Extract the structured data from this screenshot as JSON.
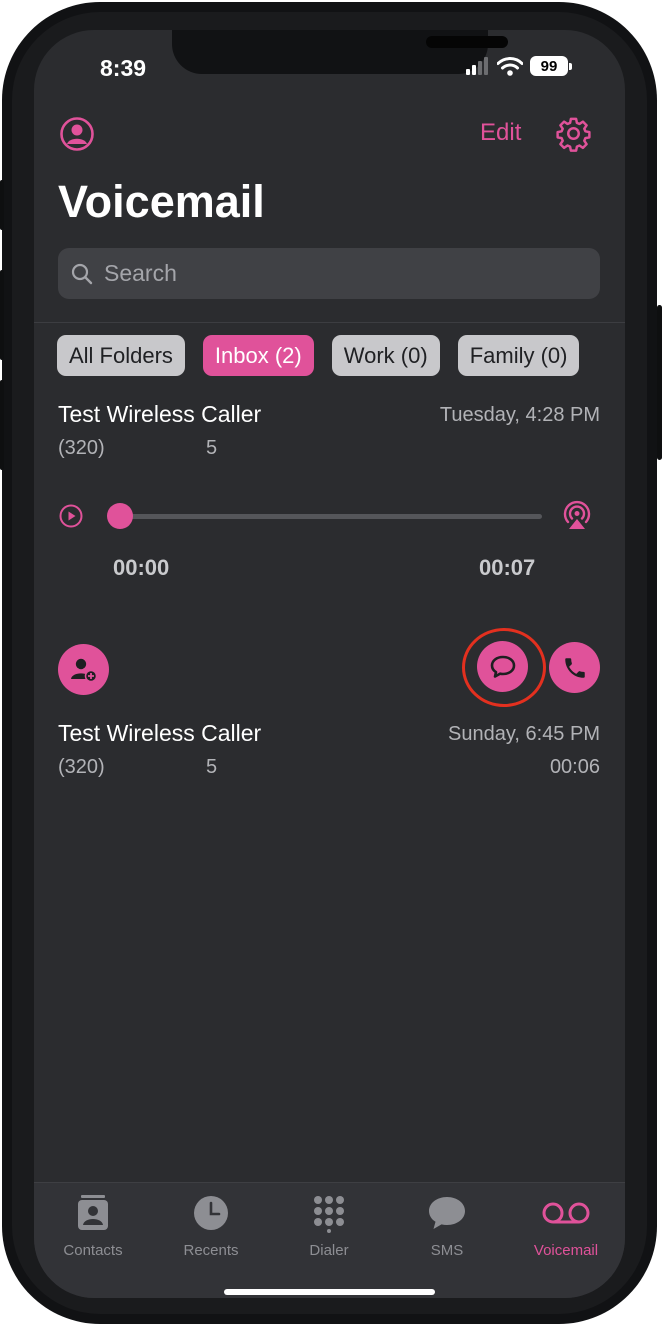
{
  "status_bar": {
    "time": "8:39",
    "battery": "99"
  },
  "header": {
    "edit_label": "Edit",
    "title": "Voicemail"
  },
  "search": {
    "placeholder": "Search"
  },
  "folders": [
    {
      "label": "All Folders",
      "active": false
    },
    {
      "label": "Inbox (2)",
      "active": true
    },
    {
      "label": "Work (0)",
      "active": false
    },
    {
      "label": "Family (0)",
      "active": false
    }
  ],
  "voicemails": [
    {
      "caller": "Test Wireless Caller",
      "area": "(320)",
      "digit": "5",
      "timestamp": "Tuesday, 4:28 PM",
      "duration": ""
    },
    {
      "caller": "Test Wireless Caller",
      "area": "(320)",
      "digit": "5",
      "timestamp": "Sunday, 6:45 PM",
      "duration": "00:06"
    }
  ],
  "player": {
    "elapsed": "00:00",
    "total": "00:07",
    "progress": 0.0
  },
  "tabs": [
    {
      "label": "Contacts",
      "icon": "contacts-icon"
    },
    {
      "label": "Recents",
      "icon": "clock-icon"
    },
    {
      "label": "Dialer",
      "icon": "keypad-icon"
    },
    {
      "label": "SMS",
      "icon": "chat-bubble-icon"
    },
    {
      "label": "Voicemail",
      "icon": "voicemail-icon"
    }
  ],
  "colors": {
    "accent": "#e0529a",
    "highlight_ring": "#e3301f",
    "background": "#2b2c2f"
  }
}
